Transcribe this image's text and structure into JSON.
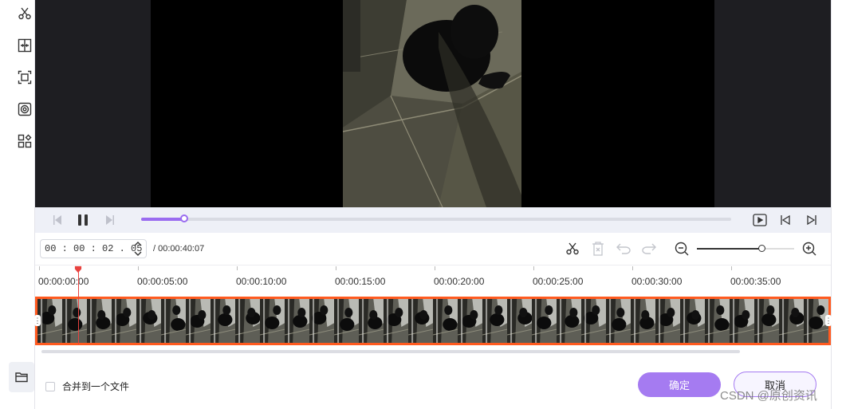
{
  "sidebar": {
    "tools": [
      "scissors-icon",
      "split-icon",
      "crop-icon",
      "target-icon",
      "more-apps-icon"
    ],
    "folder_icon": "folder-icon"
  },
  "player": {
    "progress": 0.073,
    "controls": [
      "prev-frame-icon",
      "pause-icon",
      "next-frame-icon"
    ],
    "right_controls": [
      "preview-play-icon",
      "mark-in-icon",
      "mark-out-icon"
    ]
  },
  "toolbar": {
    "timecode": "00 : 00 : 02 . 05",
    "duration": "/ 00:00:40:07",
    "tools": [
      "cut-icon",
      "delete-icon",
      "undo-icon",
      "redo-icon",
      "zoom-out-icon",
      "zoom-in-icon"
    ],
    "zoom_level": 0.66
  },
  "ruler": {
    "labels": [
      "00:00:00:00",
      "00:00:05:00",
      "00:00:10:00",
      "00:00:15:00",
      "00:00:20:00",
      "00:00:25:00",
      "00:00:30:00",
      "00:00:35:00"
    ]
  },
  "filmstrip": {
    "frame_count": 32,
    "accent": "#ff5a1f"
  },
  "footer": {
    "merge_label": "合并到一个文件",
    "ok_label": "确定",
    "cancel_label": "取消"
  },
  "watermark": "CSDN @原创资讯",
  "colors": {
    "accent": "#a57bf1",
    "playhead": "#e8423f",
    "selection": "#ff5a1f"
  }
}
